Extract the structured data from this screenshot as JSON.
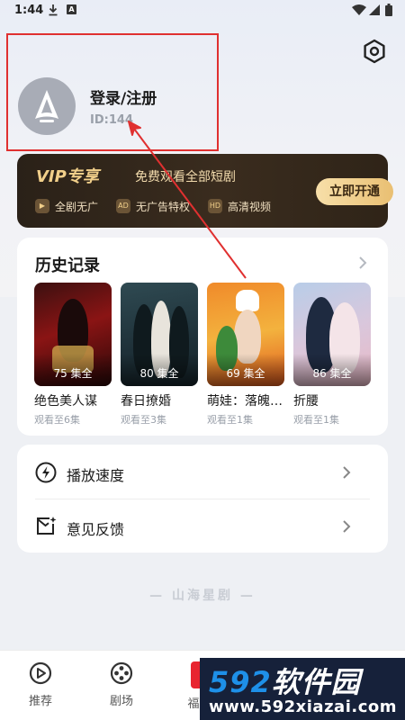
{
  "status_bar": {
    "time": "1:44",
    "download_icon": "download-icon",
    "notification_badge": "A"
  },
  "profile": {
    "login_label": "登录/注册",
    "user_id": "ID:144"
  },
  "vip": {
    "logo": "VIP专享",
    "subtitle": "免费观看全部短剧",
    "open_button": "立即开通",
    "features": [
      {
        "icon": "▶",
        "label": "全剧无广"
      },
      {
        "icon": "AD",
        "label": "无广告特权"
      },
      {
        "icon": "HD",
        "label": "高清视频"
      }
    ]
  },
  "history": {
    "title": "历史记录",
    "dramas": [
      {
        "name": "绝色美人谋",
        "episodes": "75 集全",
        "progress": "观看至6集"
      },
      {
        "name": "春日撩婚",
        "episodes": "80 集全",
        "progress": "观看至3集"
      },
      {
        "name": "萌娃：落魄…",
        "episodes": "69 集全",
        "progress": "观看至1集"
      },
      {
        "name": "折腰",
        "episodes": "86 集全",
        "progress": "观看至1集"
      }
    ]
  },
  "settings": {
    "items": [
      {
        "label": "播放速度",
        "icon": "speed-icon"
      },
      {
        "label": "意见反馈",
        "icon": "feedback-icon"
      }
    ]
  },
  "brand_footer": "— 山海星剧 —",
  "bottom_nav": {
    "items": [
      {
        "label": "推荐",
        "icon": "play-circle-icon"
      },
      {
        "label": "剧场",
        "icon": "film-reel-icon"
      },
      {
        "label": "福",
        "icon": "gift-icon"
      }
    ]
  },
  "watermark": {
    "brand_num": "592",
    "brand_text": "软件园",
    "url": "www.592xiazai.com"
  },
  "colors": {
    "vip_gold": "#f1cf8a",
    "annotation_red": "#e03030",
    "accent_red": "#e8242f"
  }
}
